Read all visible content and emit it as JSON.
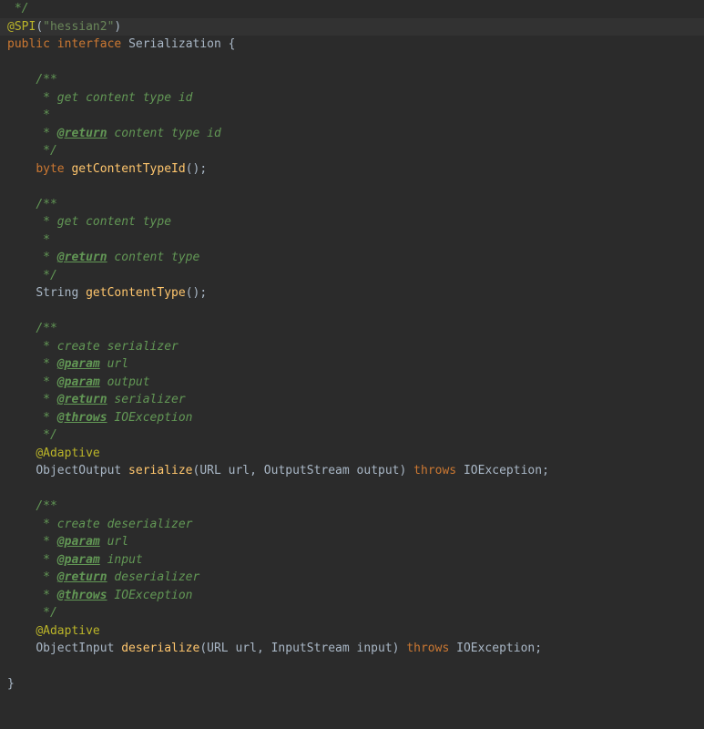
{
  "code": {
    "line1_comment": " */",
    "line2_annotation": "@SPI",
    "line2_paren_open": "(",
    "line2_string": "\"hessian2\"",
    "line2_paren_close": ")",
    "line3_public": "public",
    "line3_interface": " interface",
    "line3_name": " Serialization ",
    "line3_brace": "{",
    "indent1": "    ",
    "javadoc_open": "/**",
    "javadoc_star": " *",
    "javadoc_close": " */",
    "comment_getContentTypeId": " * get content type id",
    "return_tag": "@return",
    "return_contentTypeId": " content type id",
    "byte_kw": "byte",
    "getContentTypeId": " getContentTypeId",
    "parens_semi": "();",
    "comment_getContentType": " * get content type",
    "return_contentType": " content type",
    "string_kw": "String",
    "getContentType": " getContentType",
    "comment_createSerializer": " * create serializer",
    "param_tag": "@param",
    "param_url": " url",
    "param_output": " output",
    "return_serializer": " serializer",
    "throws_tag": "@throws",
    "throws_ioexception": " IOException",
    "adaptive_annotation": "@Adaptive",
    "objectOutput": "ObjectOutput",
    "serialize": " serialize",
    "serialize_params_open": "(URL ",
    "serialize_url": "url",
    "serialize_comma1": ", OutputStream ",
    "serialize_output": "output",
    "serialize_close": ") ",
    "throws_kw": "throws",
    "ioexception": " IOException",
    "semi": ";",
    "comment_createDeserializer": " * create deserializer",
    "param_input": " input",
    "return_deserializer": " deserializer",
    "objectInput": "ObjectInput",
    "deserialize": " deserialize",
    "deserialize_params_open": "(URL ",
    "deserialize_url": "url",
    "deserialize_comma1": ", InputStream ",
    "deserialize_input": "input",
    "deserialize_close": ") ",
    "closing_brace": "}"
  }
}
